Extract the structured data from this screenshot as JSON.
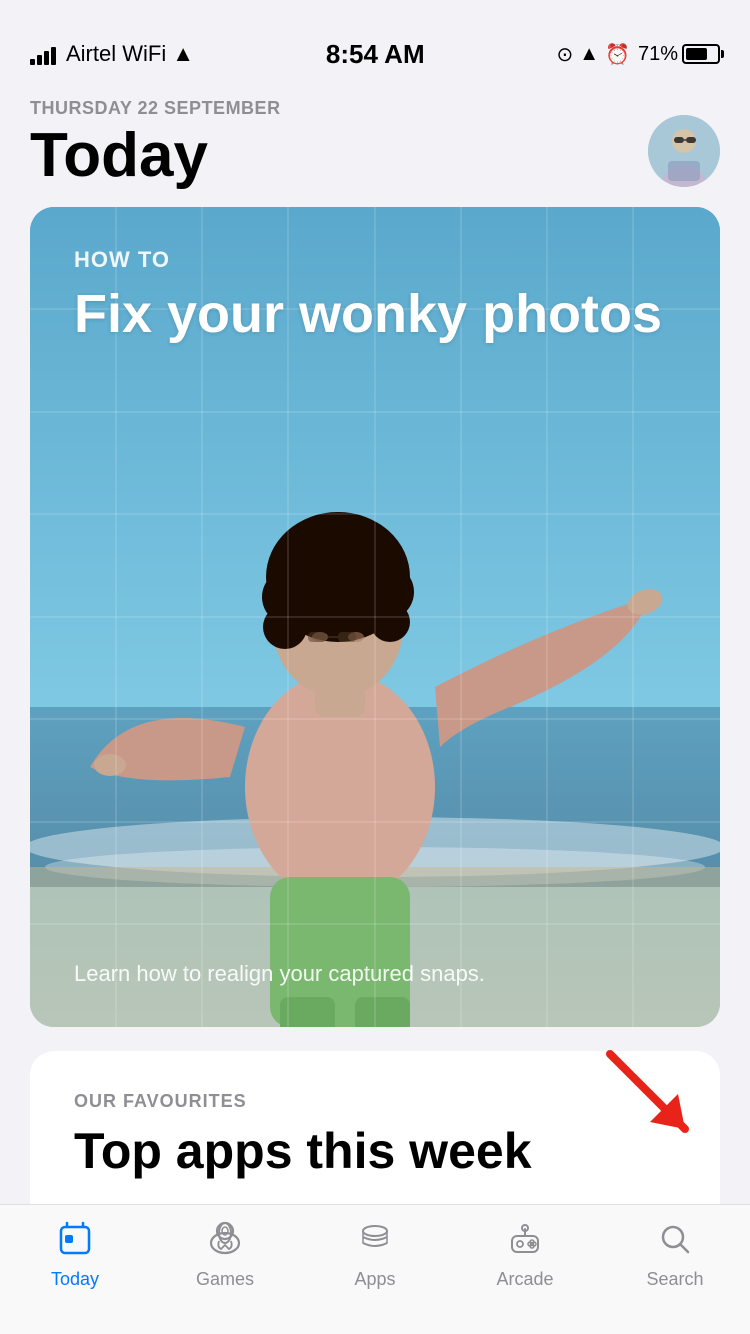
{
  "statusBar": {
    "carrier": "Airtel WiFi",
    "time": "8:54 AM",
    "battery": "71%"
  },
  "header": {
    "dateLabel": "THURSDAY 22 SEPTEMBER",
    "title": "Today"
  },
  "featuredCard": {
    "howToLabel": "HOW TO",
    "cardTitle": "Fix your wonky photos",
    "bottomText": "Learn how to realign your captured snaps."
  },
  "secondCard": {
    "ourFavouritesLabel": "OUR FAVOURITES",
    "title": "Top apps this week"
  },
  "tabBar": {
    "items": [
      {
        "id": "today",
        "label": "Today",
        "active": true
      },
      {
        "id": "games",
        "label": "Games",
        "active": false
      },
      {
        "id": "apps",
        "label": "Apps",
        "active": false
      },
      {
        "id": "arcade",
        "label": "Arcade",
        "active": false
      },
      {
        "id": "search",
        "label": "Search",
        "active": false
      }
    ]
  }
}
